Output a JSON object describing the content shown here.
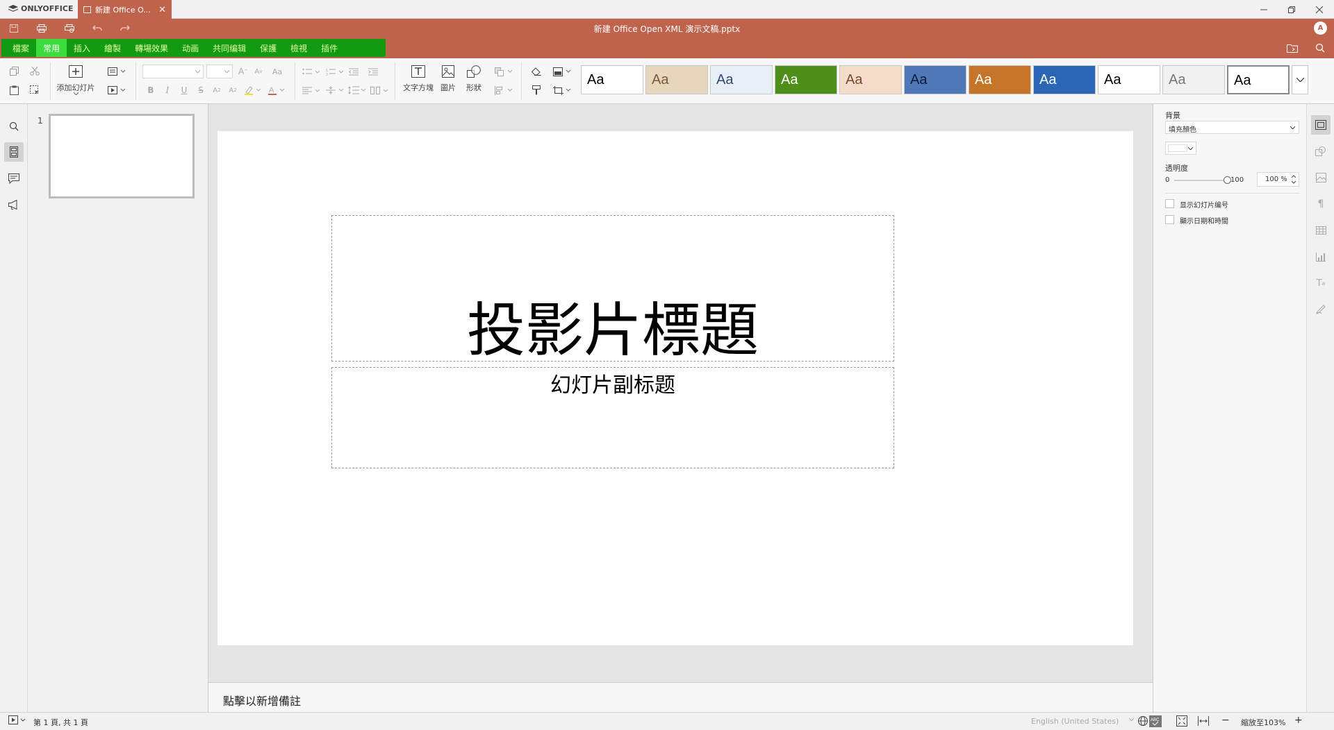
{
  "window": {
    "app_name": "ONLYOFFICE",
    "tab_label": "新建 Office O...",
    "tab_close": "✕"
  },
  "titlebar": {
    "doc_title": "新建 Office Open XML 演示文稿.pptx",
    "avatar_initial": "A"
  },
  "menu": {
    "tabs": [
      "檔案",
      "常用",
      "插入",
      "繪製",
      "轉場效果",
      "动画",
      "共同编辑",
      "保護",
      "檢視",
      "插件"
    ],
    "active_index": 1
  },
  "toolbar": {
    "add_slide_label": "添加幻灯片",
    "text_box_label": "文字方塊",
    "image_label": "圖片",
    "shape_label": "形狀",
    "font_name": "",
    "font_size": "",
    "themes": [
      {
        "name": "theme-office",
        "bg": "#ffffff",
        "text": "#000000"
      },
      {
        "name": "theme-paper",
        "bg": "#e6d6bc",
        "text": "#7a5a3a"
      },
      {
        "name": "theme-light-blue",
        "bg": "#e8eef5",
        "text": "#2e4a70"
      },
      {
        "name": "theme-green",
        "bg": "#4e8f1a",
        "text": "#ffffff"
      },
      {
        "name": "theme-peach",
        "bg": "#f3ddc9",
        "text": "#7a4a30"
      },
      {
        "name": "theme-blue-wave",
        "bg": "#4e78b8",
        "text": "#0b1c3a"
      },
      {
        "name": "theme-autumn",
        "bg": "#c4752a",
        "text": "#ffffff"
      },
      {
        "name": "theme-blue-dots",
        "bg": "#2b66b4",
        "text": "#ffffff"
      },
      {
        "name": "theme-white-blue",
        "bg": "#ffffff",
        "text": "#000000"
      },
      {
        "name": "theme-grey",
        "bg": "#f1f1f1",
        "text": "#777777"
      },
      {
        "name": "theme-blank",
        "bg": "#ffffff",
        "text": "#000000"
      }
    ],
    "theme_label": "Aa"
  },
  "thumbnails": {
    "slide_number": "1"
  },
  "slide": {
    "title": "投影片標題",
    "subtitle": "幻灯片副标题"
  },
  "notes": {
    "placeholder": "點擊以新增備註"
  },
  "right_panel": {
    "background_label": "背景",
    "fill_type": "填充顏色",
    "opacity_label": "透明度",
    "opacity_min": "0",
    "opacity_max": "100",
    "opacity_value": "100 %",
    "opacity_fraction": 1.0,
    "show_slide_number": "显示幻灯片编号",
    "show_date_time": "顯示日期和時間"
  },
  "statusbar": {
    "slide_info": "第 1 頁, 共 1 頁",
    "language": "English (United States)",
    "zoom": "縮放至103%"
  },
  "colors": {
    "brand": "#c0634c",
    "menu_highlight": "#139a13",
    "menu_active": "#3ddc3d"
  }
}
